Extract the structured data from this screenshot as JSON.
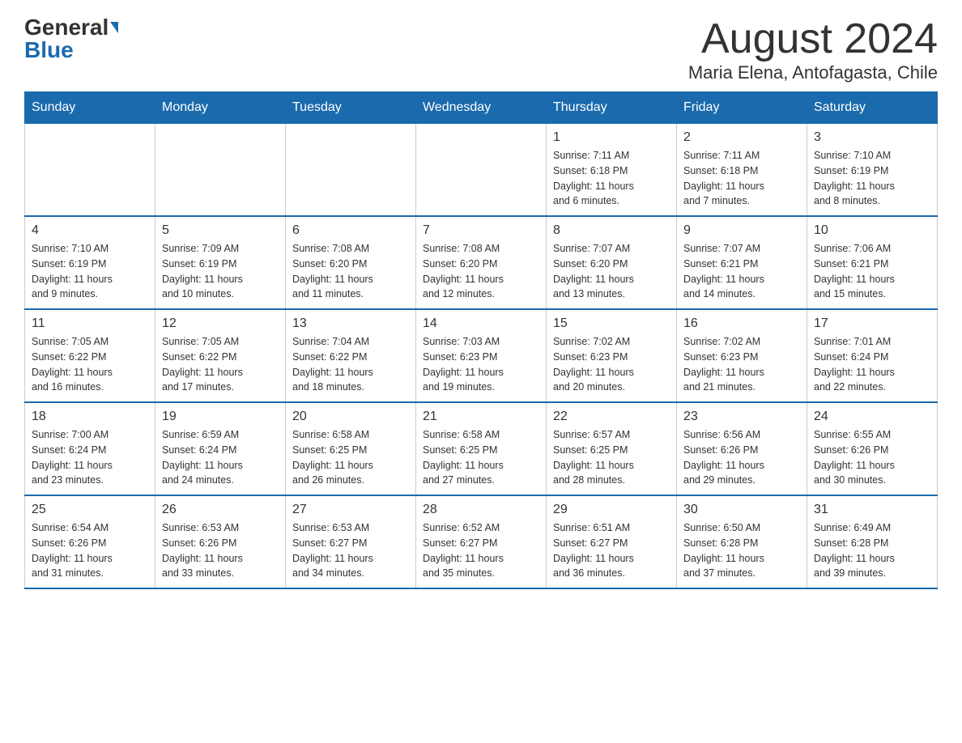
{
  "header": {
    "logo_general": "General",
    "logo_blue": "Blue",
    "month_title": "August 2024",
    "location": "Maria Elena, Antofagasta, Chile"
  },
  "days_of_week": [
    "Sunday",
    "Monday",
    "Tuesday",
    "Wednesday",
    "Thursday",
    "Friday",
    "Saturday"
  ],
  "weeks": [
    [
      {
        "day": "",
        "info": ""
      },
      {
        "day": "",
        "info": ""
      },
      {
        "day": "",
        "info": ""
      },
      {
        "day": "",
        "info": ""
      },
      {
        "day": "1",
        "info": "Sunrise: 7:11 AM\nSunset: 6:18 PM\nDaylight: 11 hours\nand 6 minutes."
      },
      {
        "day": "2",
        "info": "Sunrise: 7:11 AM\nSunset: 6:18 PM\nDaylight: 11 hours\nand 7 minutes."
      },
      {
        "day": "3",
        "info": "Sunrise: 7:10 AM\nSunset: 6:19 PM\nDaylight: 11 hours\nand 8 minutes."
      }
    ],
    [
      {
        "day": "4",
        "info": "Sunrise: 7:10 AM\nSunset: 6:19 PM\nDaylight: 11 hours\nand 9 minutes."
      },
      {
        "day": "5",
        "info": "Sunrise: 7:09 AM\nSunset: 6:19 PM\nDaylight: 11 hours\nand 10 minutes."
      },
      {
        "day": "6",
        "info": "Sunrise: 7:08 AM\nSunset: 6:20 PM\nDaylight: 11 hours\nand 11 minutes."
      },
      {
        "day": "7",
        "info": "Sunrise: 7:08 AM\nSunset: 6:20 PM\nDaylight: 11 hours\nand 12 minutes."
      },
      {
        "day": "8",
        "info": "Sunrise: 7:07 AM\nSunset: 6:20 PM\nDaylight: 11 hours\nand 13 minutes."
      },
      {
        "day": "9",
        "info": "Sunrise: 7:07 AM\nSunset: 6:21 PM\nDaylight: 11 hours\nand 14 minutes."
      },
      {
        "day": "10",
        "info": "Sunrise: 7:06 AM\nSunset: 6:21 PM\nDaylight: 11 hours\nand 15 minutes."
      }
    ],
    [
      {
        "day": "11",
        "info": "Sunrise: 7:05 AM\nSunset: 6:22 PM\nDaylight: 11 hours\nand 16 minutes."
      },
      {
        "day": "12",
        "info": "Sunrise: 7:05 AM\nSunset: 6:22 PM\nDaylight: 11 hours\nand 17 minutes."
      },
      {
        "day": "13",
        "info": "Sunrise: 7:04 AM\nSunset: 6:22 PM\nDaylight: 11 hours\nand 18 minutes."
      },
      {
        "day": "14",
        "info": "Sunrise: 7:03 AM\nSunset: 6:23 PM\nDaylight: 11 hours\nand 19 minutes."
      },
      {
        "day": "15",
        "info": "Sunrise: 7:02 AM\nSunset: 6:23 PM\nDaylight: 11 hours\nand 20 minutes."
      },
      {
        "day": "16",
        "info": "Sunrise: 7:02 AM\nSunset: 6:23 PM\nDaylight: 11 hours\nand 21 minutes."
      },
      {
        "day": "17",
        "info": "Sunrise: 7:01 AM\nSunset: 6:24 PM\nDaylight: 11 hours\nand 22 minutes."
      }
    ],
    [
      {
        "day": "18",
        "info": "Sunrise: 7:00 AM\nSunset: 6:24 PM\nDaylight: 11 hours\nand 23 minutes."
      },
      {
        "day": "19",
        "info": "Sunrise: 6:59 AM\nSunset: 6:24 PM\nDaylight: 11 hours\nand 24 minutes."
      },
      {
        "day": "20",
        "info": "Sunrise: 6:58 AM\nSunset: 6:25 PM\nDaylight: 11 hours\nand 26 minutes."
      },
      {
        "day": "21",
        "info": "Sunrise: 6:58 AM\nSunset: 6:25 PM\nDaylight: 11 hours\nand 27 minutes."
      },
      {
        "day": "22",
        "info": "Sunrise: 6:57 AM\nSunset: 6:25 PM\nDaylight: 11 hours\nand 28 minutes."
      },
      {
        "day": "23",
        "info": "Sunrise: 6:56 AM\nSunset: 6:26 PM\nDaylight: 11 hours\nand 29 minutes."
      },
      {
        "day": "24",
        "info": "Sunrise: 6:55 AM\nSunset: 6:26 PM\nDaylight: 11 hours\nand 30 minutes."
      }
    ],
    [
      {
        "day": "25",
        "info": "Sunrise: 6:54 AM\nSunset: 6:26 PM\nDaylight: 11 hours\nand 31 minutes."
      },
      {
        "day": "26",
        "info": "Sunrise: 6:53 AM\nSunset: 6:26 PM\nDaylight: 11 hours\nand 33 minutes."
      },
      {
        "day": "27",
        "info": "Sunrise: 6:53 AM\nSunset: 6:27 PM\nDaylight: 11 hours\nand 34 minutes."
      },
      {
        "day": "28",
        "info": "Sunrise: 6:52 AM\nSunset: 6:27 PM\nDaylight: 11 hours\nand 35 minutes."
      },
      {
        "day": "29",
        "info": "Sunrise: 6:51 AM\nSunset: 6:27 PM\nDaylight: 11 hours\nand 36 minutes."
      },
      {
        "day": "30",
        "info": "Sunrise: 6:50 AM\nSunset: 6:28 PM\nDaylight: 11 hours\nand 37 minutes."
      },
      {
        "day": "31",
        "info": "Sunrise: 6:49 AM\nSunset: 6:28 PM\nDaylight: 11 hours\nand 39 minutes."
      }
    ]
  ]
}
